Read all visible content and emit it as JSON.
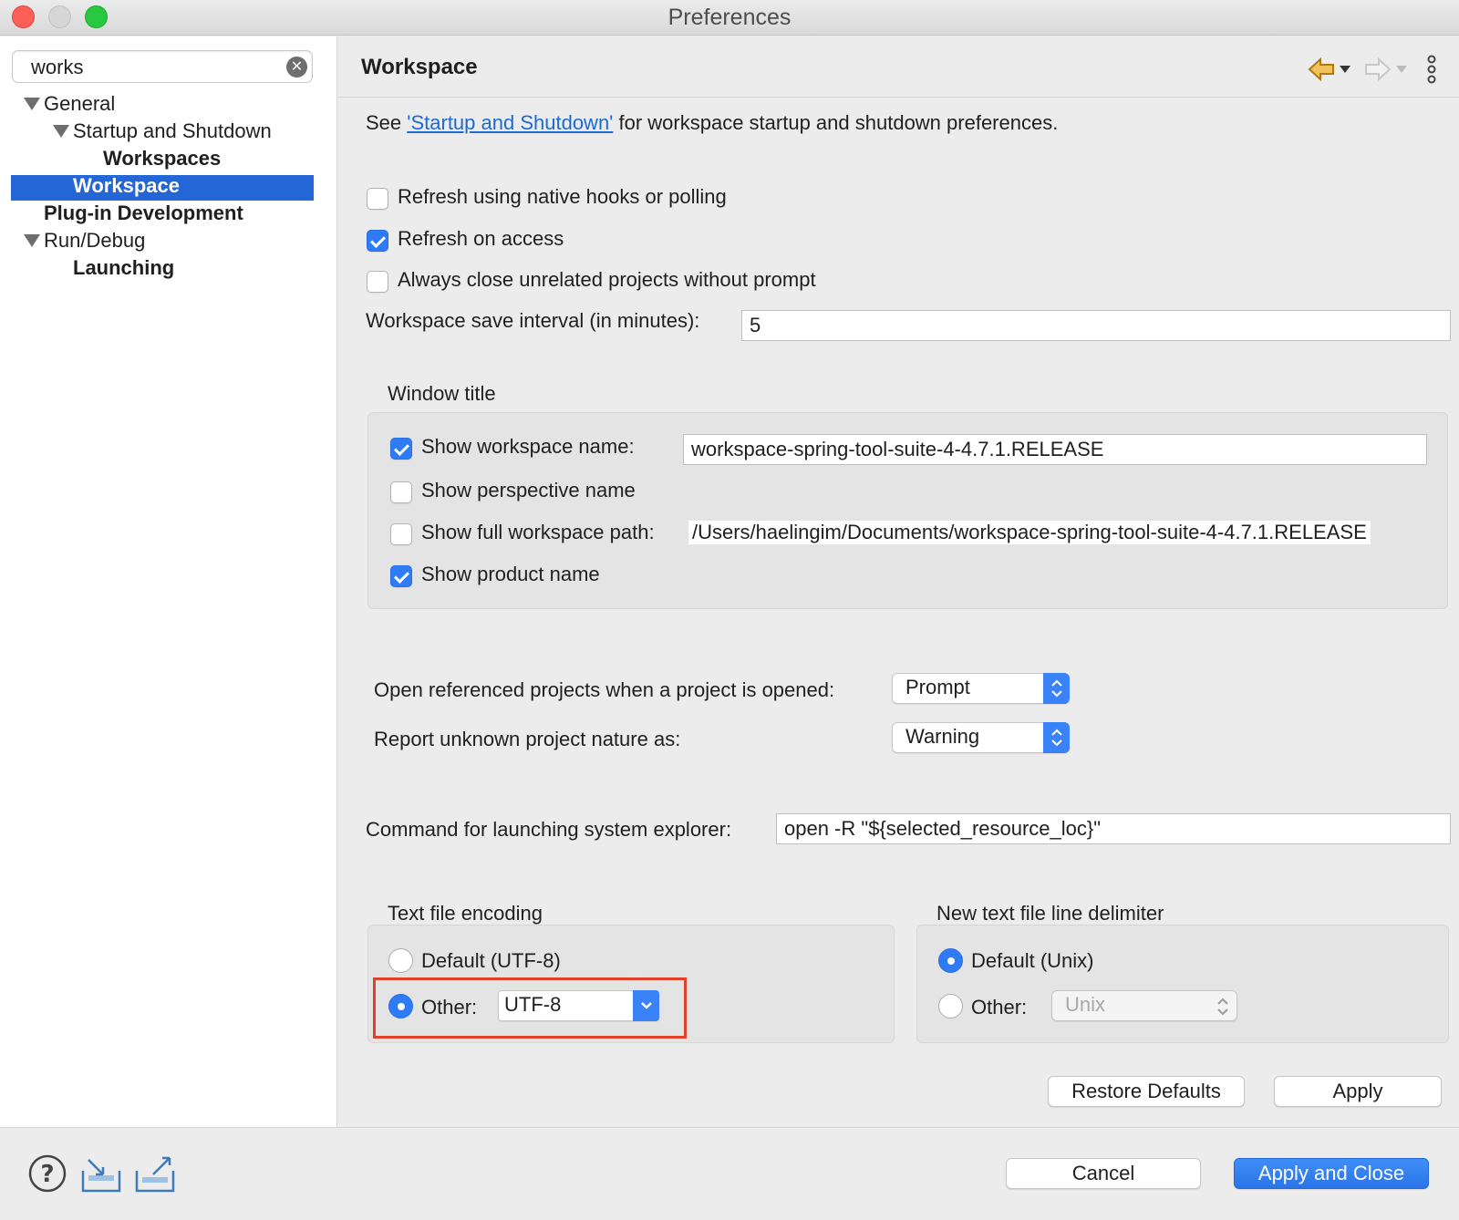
{
  "window": {
    "title": "Preferences"
  },
  "sidebar": {
    "search_value": "works",
    "tree": {
      "general": "General",
      "startup_shutdown": "Startup and Shutdown",
      "workspaces": "Workspaces",
      "workspace": "Workspace",
      "plugin_dev": "Plug-in Development",
      "run_debug": "Run/Debug",
      "launching": "Launching"
    }
  },
  "main": {
    "title": "Workspace",
    "intro": {
      "prefix": "See ",
      "link": "'Startup and Shutdown'",
      "suffix": " for workspace startup and shutdown preferences."
    },
    "options": {
      "refresh_native": {
        "label": "Refresh using native hooks or polling",
        "checked": false
      },
      "refresh_access": {
        "label": "Refresh on access",
        "checked": true
      },
      "always_close": {
        "label": "Always close unrelated projects without prompt",
        "checked": false
      }
    },
    "save_interval": {
      "label": "Workspace save interval (in minutes):",
      "value": "5"
    },
    "window_title": {
      "legend": "Window title",
      "show_workspace_name": {
        "label": "Show workspace name:",
        "checked": true,
        "value": "workspace-spring-tool-suite-4-4.7.1.RELEASE"
      },
      "show_perspective_name": {
        "label": "Show perspective name",
        "checked": false
      },
      "show_full_path": {
        "label": "Show full workspace path:",
        "checked": false,
        "value": "/Users/haelingim/Documents/workspace-spring-tool-suite-4-4.7.1.RELEASE"
      },
      "show_product_name": {
        "label": "Show product name",
        "checked": true
      }
    },
    "open_referenced": {
      "label": "Open referenced projects when a project is opened:",
      "value": "Prompt"
    },
    "report_unknown": {
      "label": "Report unknown project nature as:",
      "value": "Warning"
    },
    "command_explorer": {
      "label": "Command for launching system explorer:",
      "value": "open -R \"${selected_resource_loc}\""
    },
    "encoding": {
      "legend": "Text file encoding",
      "default_label": "Default (UTF-8)",
      "other_label": "Other:",
      "other_value": "UTF-8",
      "selected": "other"
    },
    "line_delimiter": {
      "legend": "New text file line delimiter",
      "default_label": "Default (Unix)",
      "other_label": "Other:",
      "other_value": "Unix",
      "selected": "default"
    },
    "buttons": {
      "restore_defaults": "Restore Defaults",
      "apply": "Apply"
    }
  },
  "footer": {
    "cancel": "Cancel",
    "apply_close": "Apply and Close"
  },
  "colors": {
    "accent": "#2f7bf6",
    "selection": "#2566d6",
    "highlight_box": "#e0412b",
    "link": "#1a6ad8"
  }
}
